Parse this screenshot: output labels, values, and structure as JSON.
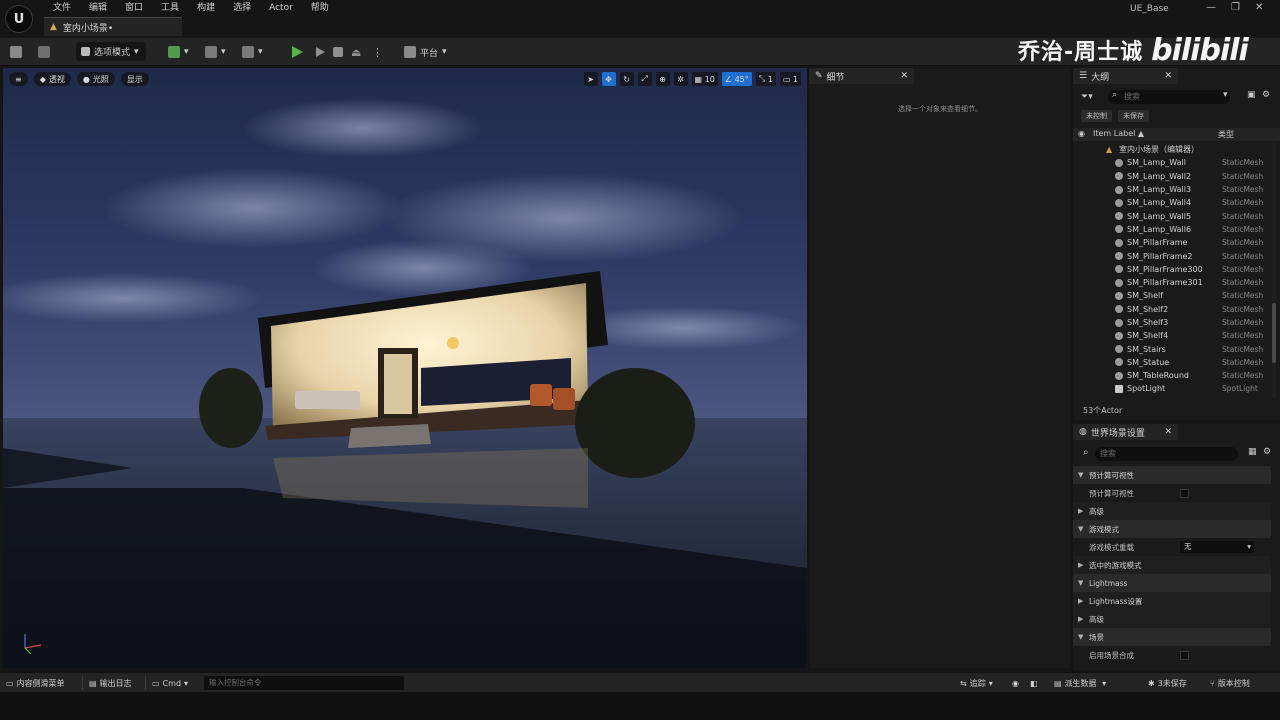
{
  "app": {
    "name": "UE_Base",
    "logo_glyph": "U"
  },
  "menu": [
    "文件",
    "编辑",
    "窗口",
    "工具",
    "构建",
    "选择",
    "Actor",
    "帮助"
  ],
  "document_tab": {
    "label": "室内小场景•"
  },
  "window_controls": [
    "—",
    "❐",
    "✕"
  ],
  "toolbar": {
    "mode_label": "选项模式",
    "platform_label": "平台"
  },
  "watermark": {
    "name": "乔治-周士诚",
    "logo": "bilibili"
  },
  "viewport": {
    "perspective": "透视",
    "lighting": "光照",
    "show": "显示",
    "grid_size": "10",
    "rotation_snap": "45°",
    "scale_snap": "1",
    "camera_speed": "1"
  },
  "details": {
    "tab_label": "细节",
    "hint": "选择一个对象来查看细节。"
  },
  "outliner": {
    "tab_label": "大纲",
    "search_placeholder": "搜索",
    "filters": [
      "未控制",
      "未保存"
    ],
    "col_label": "Item Label ▲",
    "col_type": "类型",
    "root": "室内小场景（编辑器）",
    "rows": [
      {
        "name": "SM_Lamp_Wall",
        "type": "StaticMesh"
      },
      {
        "name": "SM_Lamp_Wall2",
        "type": "StaticMesh"
      },
      {
        "name": "SM_Lamp_Wall3",
        "type": "StaticMesh"
      },
      {
        "name": "SM_Lamp_Wall4",
        "type": "StaticMesh"
      },
      {
        "name": "SM_Lamp_Wall5",
        "type": "StaticMesh"
      },
      {
        "name": "SM_Lamp_Wall6",
        "type": "StaticMesh"
      },
      {
        "name": "SM_PillarFrame",
        "type": "StaticMesh"
      },
      {
        "name": "SM_PillarFrame2",
        "type": "StaticMesh"
      },
      {
        "name": "SM_PillarFrame300",
        "type": "StaticMesh"
      },
      {
        "name": "SM_PillarFrame301",
        "type": "StaticMesh"
      },
      {
        "name": "SM_Shelf",
        "type": "StaticMesh"
      },
      {
        "name": "SM_Shelf2",
        "type": "StaticMesh"
      },
      {
        "name": "SM_Shelf3",
        "type": "StaticMesh"
      },
      {
        "name": "SM_Shelf4",
        "type": "StaticMesh"
      },
      {
        "name": "SM_Stairs",
        "type": "StaticMesh"
      },
      {
        "name": "SM_Statue",
        "type": "StaticMesh"
      },
      {
        "name": "SM_TableRound",
        "type": "StaticMesh"
      },
      {
        "name": "SpotLight",
        "type": "SpotLight"
      }
    ],
    "count": "53个Actor"
  },
  "world_settings": {
    "tab_label": "世界场景设置",
    "search_placeholder": "搜索",
    "rows": [
      {
        "kind": "cat",
        "label": "预计算可视性",
        "arrow": "▼"
      },
      {
        "kind": "prop",
        "label": "预计算可视性",
        "control": "check"
      },
      {
        "kind": "sub",
        "label": "高级",
        "arrow": "▶"
      },
      {
        "kind": "cat",
        "label": "游戏模式",
        "arrow": "▼"
      },
      {
        "kind": "prop",
        "label": "游戏模式重载",
        "control": "select",
        "value": "无"
      },
      {
        "kind": "sub",
        "label": "选中的游戏模式",
        "arrow": "▶"
      },
      {
        "kind": "cat",
        "label": "Lightmass",
        "arrow": "▼"
      },
      {
        "kind": "sub",
        "label": "Lightmass设置",
        "arrow": "▶"
      },
      {
        "kind": "sub",
        "label": "高级",
        "arrow": "▶"
      },
      {
        "kind": "cat",
        "label": "场景",
        "arrow": "▼"
      },
      {
        "kind": "prop",
        "label": "启用场景合成",
        "control": "check"
      }
    ]
  },
  "statusbar": {
    "content_drawer": "内容侧滑菜单",
    "output_log": "输出日志",
    "cmd": "Cmd",
    "cmd_placeholder": "输入控制台命令",
    "trace": "追踪",
    "derived_data": "派生数据",
    "unsaved": "3未保存",
    "source_control": "版本控制"
  },
  "colors": {
    "accent_blue": "#1e6fd0",
    "play_green": "#56b24b",
    "panel_bg": "#1a1a1a",
    "toolbar_bg": "#242424"
  }
}
